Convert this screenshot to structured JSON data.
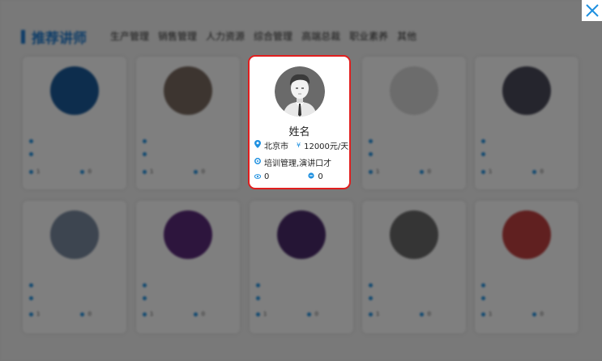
{
  "section": {
    "title": "推荐讲师"
  },
  "tabs": [
    "生产管理",
    "销售管理",
    "人力资源",
    "综合管理",
    "高端总裁",
    "职业素养",
    "其他"
  ],
  "background_cards": [
    {
      "name": "",
      "city": "",
      "price": "",
      "tags": "",
      "views": "1",
      "likes": "0",
      "avatar_color": "#1a5a9a"
    },
    {
      "name": "",
      "city": "",
      "price": "",
      "tags": "",
      "views": "1",
      "likes": "0",
      "avatar_color": "#7a6a60"
    },
    {
      "name": "",
      "city": "",
      "price": "",
      "tags": "",
      "views": "1",
      "likes": "0",
      "avatar_color": "#d8d8d8"
    },
    {
      "name": "",
      "city": "",
      "price": "",
      "tags": "",
      "views": "1",
      "likes": "0",
      "avatar_color": "#4a4a5a"
    },
    {
      "name": "",
      "city": "",
      "price": "",
      "tags": "",
      "views": "1",
      "likes": "0",
      "avatar_color": "#7a8aa0"
    },
    {
      "name": "",
      "city": "",
      "price": "",
      "tags": "",
      "views": "1",
      "likes": "0",
      "avatar_color": "#5a2a7a"
    },
    {
      "name": "",
      "city": "",
      "price": "",
      "tags": "",
      "views": "1",
      "likes": "0",
      "avatar_color": "#4a2a6a"
    },
    {
      "name": "",
      "city": "",
      "price": "",
      "tags": "",
      "views": "1",
      "likes": "0",
      "avatar_color": "#6a6a6a"
    },
    {
      "name": "",
      "city": "",
      "price": "",
      "tags": "",
      "views": "1",
      "likes": "0",
      "avatar_color": "#c04040"
    }
  ],
  "highlight_card": {
    "name": "姓名",
    "city": "北京市",
    "price": "12000元/天",
    "tags": "培训管理,演讲口才",
    "views": "0",
    "likes": "0"
  },
  "colors": {
    "accent": "#1e7bd1",
    "highlight_border": "#e01e1e",
    "close": "#1e90e0"
  },
  "icons": {
    "close": "close-icon",
    "location": "location-pin-icon",
    "price": "yen-icon",
    "tag": "tag-icon",
    "views": "eye-icon",
    "likes": "like-icon"
  }
}
